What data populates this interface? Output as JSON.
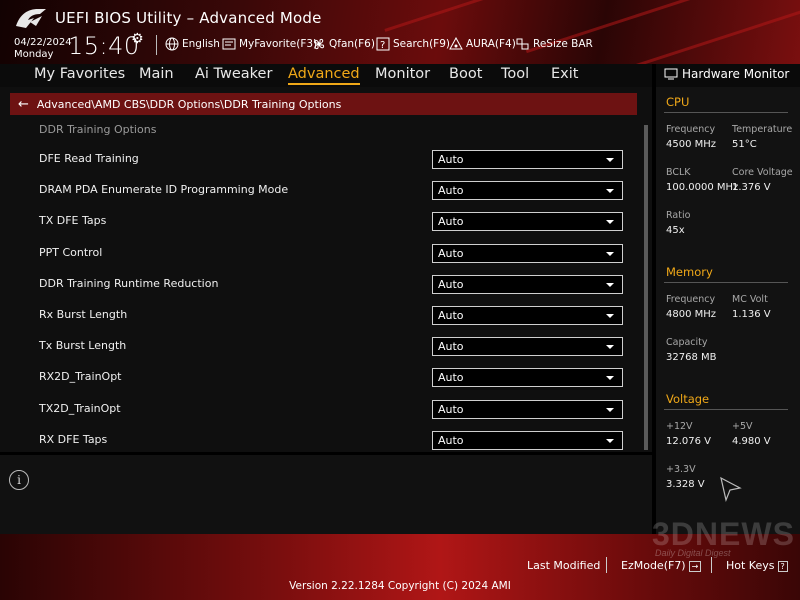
{
  "header": {
    "title": "UEFI BIOS Utility – Advanced Mode",
    "date": "04/22/2024",
    "weekday": "Monday",
    "time": "15:40",
    "items": {
      "language": "English",
      "myfavorite": "MyFavorite(F3)",
      "qfan": "Qfan(F6)",
      "search": "Search(F9)",
      "aura": "AURA(F4)",
      "resize_bar": "ReSize BAR"
    }
  },
  "menu": {
    "favorites": "My Favorites",
    "main": "Main",
    "ai_tweaker": "Ai Tweaker",
    "advanced": "Advanced",
    "monitor": "Monitor",
    "boot": "Boot",
    "tool": "Tool",
    "exit": "Exit",
    "active": "Advanced"
  },
  "breadcrumb": "Advanced\\AMD CBS\\DDR Options\\DDR Training Options",
  "section_title": "DDR Training Options",
  "options": [
    {
      "label": "DFE Read Training",
      "value": "Auto"
    },
    {
      "label": "DRAM PDA Enumerate ID Programming Mode",
      "value": "Auto"
    },
    {
      "label": "TX DFE Taps",
      "value": "Auto"
    },
    {
      "label": "PPT Control",
      "value": "Auto"
    },
    {
      "label": "DDR Training Runtime Reduction",
      "value": "Auto"
    },
    {
      "label": "Rx Burst Length",
      "value": "Auto"
    },
    {
      "label": "Tx Burst Length",
      "value": "Auto"
    },
    {
      "label": "RX2D_TrainOpt",
      "value": "Auto"
    },
    {
      "label": "TX2D_TrainOpt",
      "value": "Auto"
    },
    {
      "label": "RX DFE Taps",
      "value": "Auto"
    }
  ],
  "hw_monitor": {
    "title": "Hardware Monitor",
    "cpu": {
      "heading": "CPU",
      "frequency_label": "Frequency",
      "frequency": "4500 MHz",
      "temperature_label": "Temperature",
      "temperature": "51°C",
      "bclk_label": "BCLK",
      "bclk": "100.0000 MHz",
      "core_voltage_label": "Core Voltage",
      "core_voltage": "1.376 V",
      "ratio_label": "Ratio",
      "ratio": "45x"
    },
    "memory": {
      "heading": "Memory",
      "frequency_label": "Frequency",
      "frequency": "4800 MHz",
      "mc_volt_label": "MC Volt",
      "mc_volt": "1.136 V",
      "capacity_label": "Capacity",
      "capacity": "32768 MB"
    },
    "voltage": {
      "heading": "Voltage",
      "v12_label": "+12V",
      "v12": "12.076 V",
      "v5_label": "+5V",
      "v5": "4.980 V",
      "v33_label": "+3.3V",
      "v33": "3.328 V"
    }
  },
  "footer": {
    "last_modified": "Last Modified",
    "ezmode": "EzMode(F7)",
    "hot_keys": "Hot Keys",
    "version": "Version 2.22.1284 Copyright (C) 2024 AMI"
  },
  "watermark": {
    "brand": "3DNEWS",
    "tagline": "Daily Digital Digest"
  },
  "colors": {
    "accent": "#f0a818",
    "breadcrumb_bg": "#6d1212",
    "brand_red": "#b01616"
  }
}
